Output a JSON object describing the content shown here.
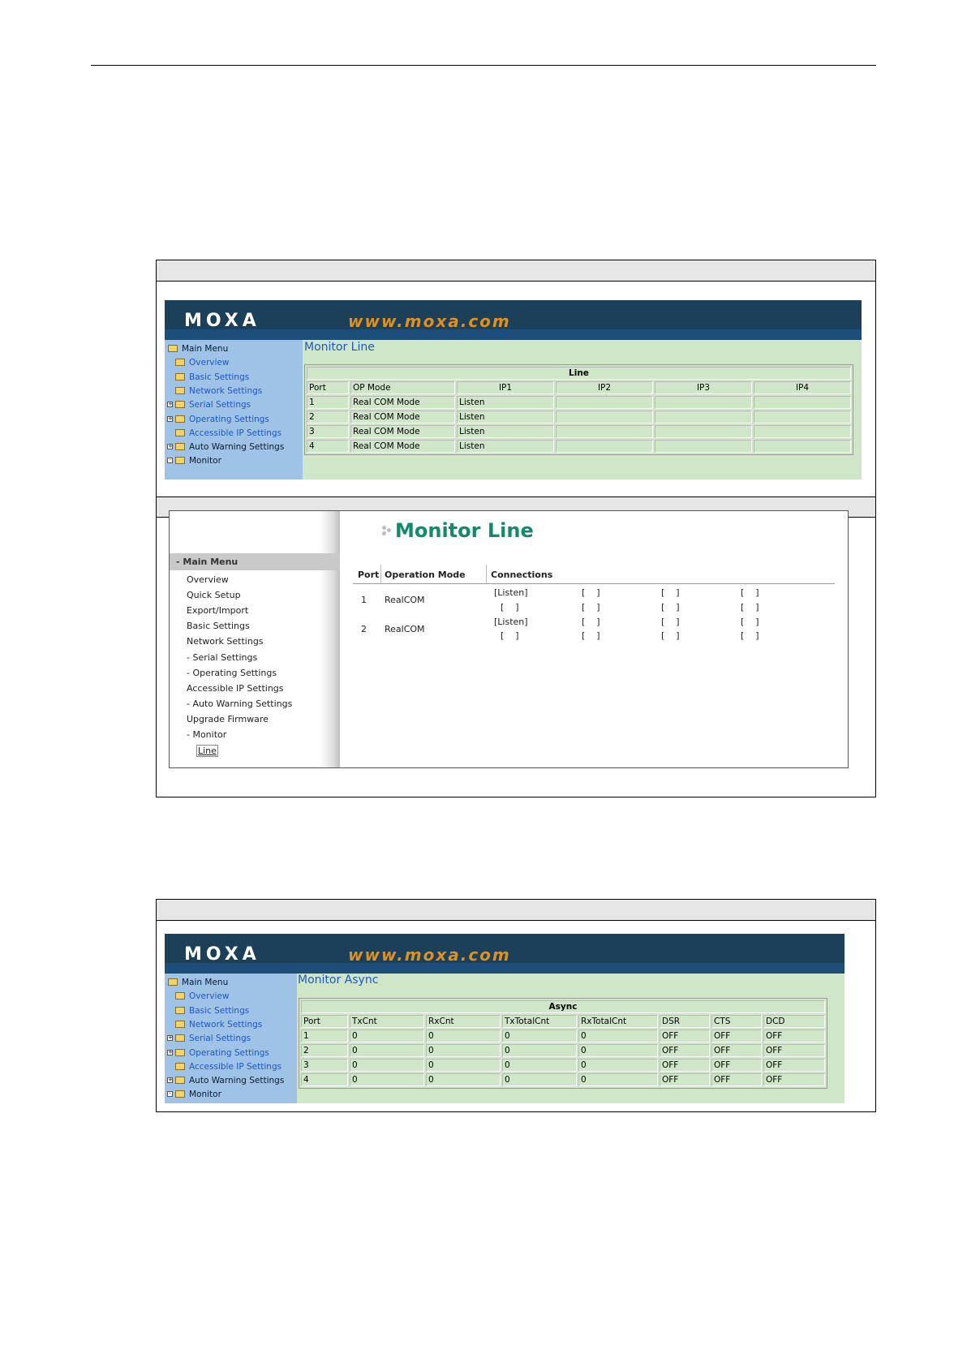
{
  "fig1": {
    "banner": {
      "logo": "MOXA",
      "url": "www.moxa.com"
    },
    "menu": [
      {
        "label": "Main Menu",
        "style": "dark",
        "indent": 0,
        "expander": ""
      },
      {
        "label": "Overview",
        "style": "link",
        "indent": 1,
        "expander": ""
      },
      {
        "label": "Basic Settings",
        "style": "link",
        "indent": 1,
        "expander": ""
      },
      {
        "label": "Network Settings",
        "style": "link",
        "indent": 1,
        "expander": ""
      },
      {
        "label": "Serial Settings",
        "style": "link",
        "indent": 1,
        "expander": "+"
      },
      {
        "label": "Operating Settings",
        "style": "link",
        "indent": 1,
        "expander": "+"
      },
      {
        "label": "Accessible IP Settings",
        "style": "link",
        "indent": 1,
        "expander": ""
      },
      {
        "label": "Auto Warning Settings",
        "style": "dark",
        "indent": 1,
        "expander": "+"
      },
      {
        "label": "Monitor",
        "style": "dark",
        "indent": 1,
        "expander": "-"
      }
    ],
    "title": "Monitor Line",
    "table": {
      "caption": "Line",
      "headers": [
        "Port",
        "OP Mode",
        "IP1",
        "IP2",
        "IP3",
        "IP4"
      ],
      "rows": [
        [
          "1",
          "Real COM Mode",
          "Listen",
          "",
          "",
          ""
        ],
        [
          "2",
          "Real COM Mode",
          "Listen",
          "",
          "",
          ""
        ],
        [
          "3",
          "Real COM Mode",
          "Listen",
          "",
          "",
          ""
        ],
        [
          "4",
          "Real COM Mode",
          "Listen",
          "",
          "",
          ""
        ]
      ]
    }
  },
  "fig2": {
    "menu_header": "- Main Menu",
    "menu": [
      {
        "label": "Overview",
        "indent": 0
      },
      {
        "label": "Quick Setup",
        "indent": 0
      },
      {
        "label": "Export/Import",
        "indent": 0
      },
      {
        "label": "Basic Settings",
        "indent": 0
      },
      {
        "label": "Network Settings",
        "indent": 0
      },
      {
        "label": "- Serial Settings",
        "indent": 0
      },
      {
        "label": "- Operating Settings",
        "indent": 0
      },
      {
        "label": "Accessible IP Settings",
        "indent": 0
      },
      {
        "label": "- Auto Warning Settings",
        "indent": 0
      },
      {
        "label": "Upgrade Firmware",
        "indent": 0
      },
      {
        "label": "- Monitor",
        "indent": 0
      },
      {
        "label": "Line",
        "indent": 1
      }
    ],
    "title": "Monitor Line",
    "table": {
      "headers": [
        "Port",
        "Operation Mode",
        "Connections"
      ],
      "rows": [
        {
          "port": "1",
          "mode": "RealCOM",
          "connections": [
            [
              "[Listen]",
              "[    ]",
              "[    ]",
              "[    ]"
            ],
            [
              "[    ]",
              "[    ]",
              "[    ]",
              "[    ]"
            ]
          ]
        },
        {
          "port": "2",
          "mode": "RealCOM",
          "connections": [
            [
              "[Listen]",
              "[    ]",
              "[    ]",
              "[    ]"
            ],
            [
              "[    ]",
              "[    ]",
              "[    ]",
              "[    ]"
            ]
          ]
        }
      ]
    }
  },
  "fig3": {
    "banner": {
      "logo": "MOXA",
      "url": "www.moxa.com"
    },
    "menu": [
      {
        "label": "Main Menu",
        "style": "dark",
        "indent": 0,
        "expander": ""
      },
      {
        "label": "Overview",
        "style": "link",
        "indent": 1,
        "expander": ""
      },
      {
        "label": "Basic Settings",
        "style": "link",
        "indent": 1,
        "expander": ""
      },
      {
        "label": "Network Settings",
        "style": "link",
        "indent": 1,
        "expander": ""
      },
      {
        "label": "Serial Settings",
        "style": "link",
        "indent": 1,
        "expander": "+"
      },
      {
        "label": "Operating Settings",
        "style": "link",
        "indent": 1,
        "expander": "+"
      },
      {
        "label": "Accessible IP Settings",
        "style": "link",
        "indent": 1,
        "expander": ""
      },
      {
        "label": "Auto Warning Settings",
        "style": "dark",
        "indent": 1,
        "expander": "+"
      },
      {
        "label": "Monitor",
        "style": "dark",
        "indent": 1,
        "expander": "-"
      }
    ],
    "title": "Monitor Async",
    "table": {
      "caption": "Async",
      "headers": [
        "Port",
        "TxCnt",
        "RxCnt",
        "TxTotalCnt",
        "RxTotalCnt",
        "DSR",
        "CTS",
        "DCD"
      ],
      "rows": [
        [
          "1",
          "0",
          "0",
          "0",
          "0",
          "OFF",
          "OFF",
          "OFF"
        ],
        [
          "2",
          "0",
          "0",
          "0",
          "0",
          "OFF",
          "OFF",
          "OFF"
        ],
        [
          "3",
          "0",
          "0",
          "0",
          "0",
          "OFF",
          "OFF",
          "OFF"
        ],
        [
          "4",
          "0",
          "0",
          "0",
          "0",
          "OFF",
          "OFF",
          "OFF"
        ]
      ]
    }
  },
  "colors": {
    "banner": "#1c3f5a",
    "url": "#e0901c",
    "sidebar": "#9ec3e6",
    "content": "#cfe6c8",
    "link": "#1e56c8",
    "newui_title": "#138a6e"
  }
}
